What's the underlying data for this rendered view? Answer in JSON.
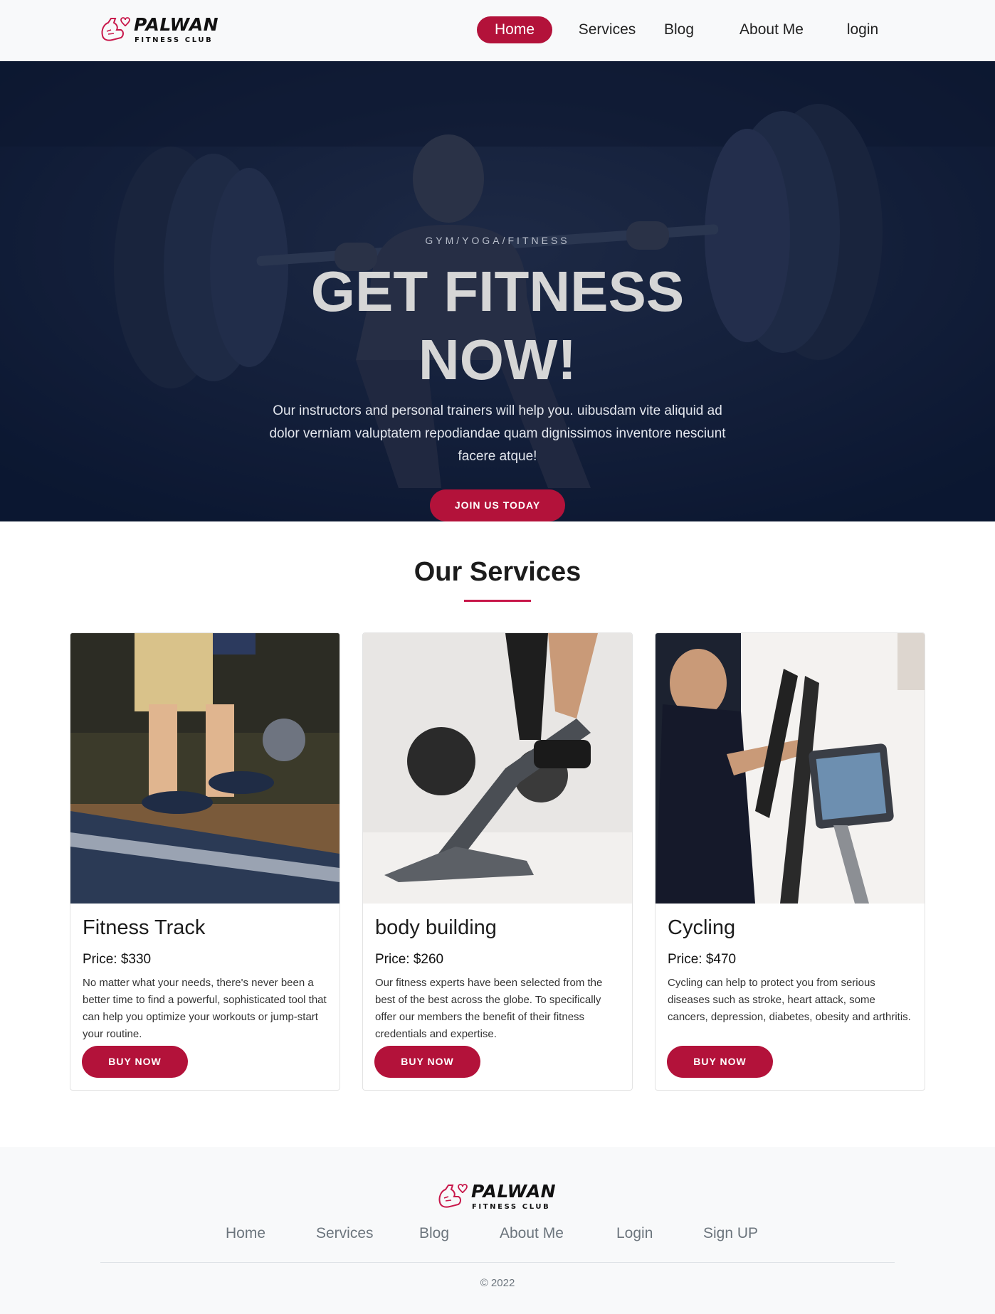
{
  "brand": {
    "name": "PALWAN",
    "tagline": "FITNESS CLUB"
  },
  "nav": {
    "items": [
      {
        "label": "Home",
        "active": true
      },
      {
        "label": "Services",
        "active": false
      },
      {
        "label": "Blog",
        "active": false
      },
      {
        "label": "About Me",
        "active": false
      },
      {
        "label": "login",
        "active": false
      }
    ]
  },
  "hero": {
    "eyebrow": "GYM/YOGA/FITNESS",
    "title": "GET FITNESS NOW!",
    "text": "Our instructors and personal trainers will help you. uibusdam vite aliquid ad dolor verniam valuptatem repodiandae quam dignissimos inventore nesciunt facere atque!",
    "cta": "JOIN US TODAY"
  },
  "services": {
    "title": "Our Services",
    "cards": [
      {
        "title": "Fitness Track",
        "price": "Price: $330",
        "description": "No matter what your needs, there's never been a better time to find a powerful, sophisticated tool that can help you optimize your workouts or jump-start your routine.",
        "button": "BUY NOW"
      },
      {
        "title": "body building",
        "price": "Price: $260",
        "description": "Our fitness experts have been selected from the best of the best across the globe. To specifically offer our members the benefit of their fitness credentials and expertise.",
        "button": "BUY NOW"
      },
      {
        "title": "Cycling",
        "price": "Price: $470",
        "description": "Cycling can help to protect you from serious diseases such as stroke, heart attack, some cancers, depression, diabetes, obesity and arthritis.",
        "button": "BUY NOW"
      }
    ]
  },
  "footer": {
    "links": [
      "Home",
      "Services",
      "Blog",
      "About Me",
      "Login",
      "Sign UP"
    ],
    "copyright": "© 2022"
  },
  "colors": {
    "accent": "#b3123a",
    "hero_overlay": "#0d1a33",
    "navbar_bg": "#f8f9fa"
  }
}
